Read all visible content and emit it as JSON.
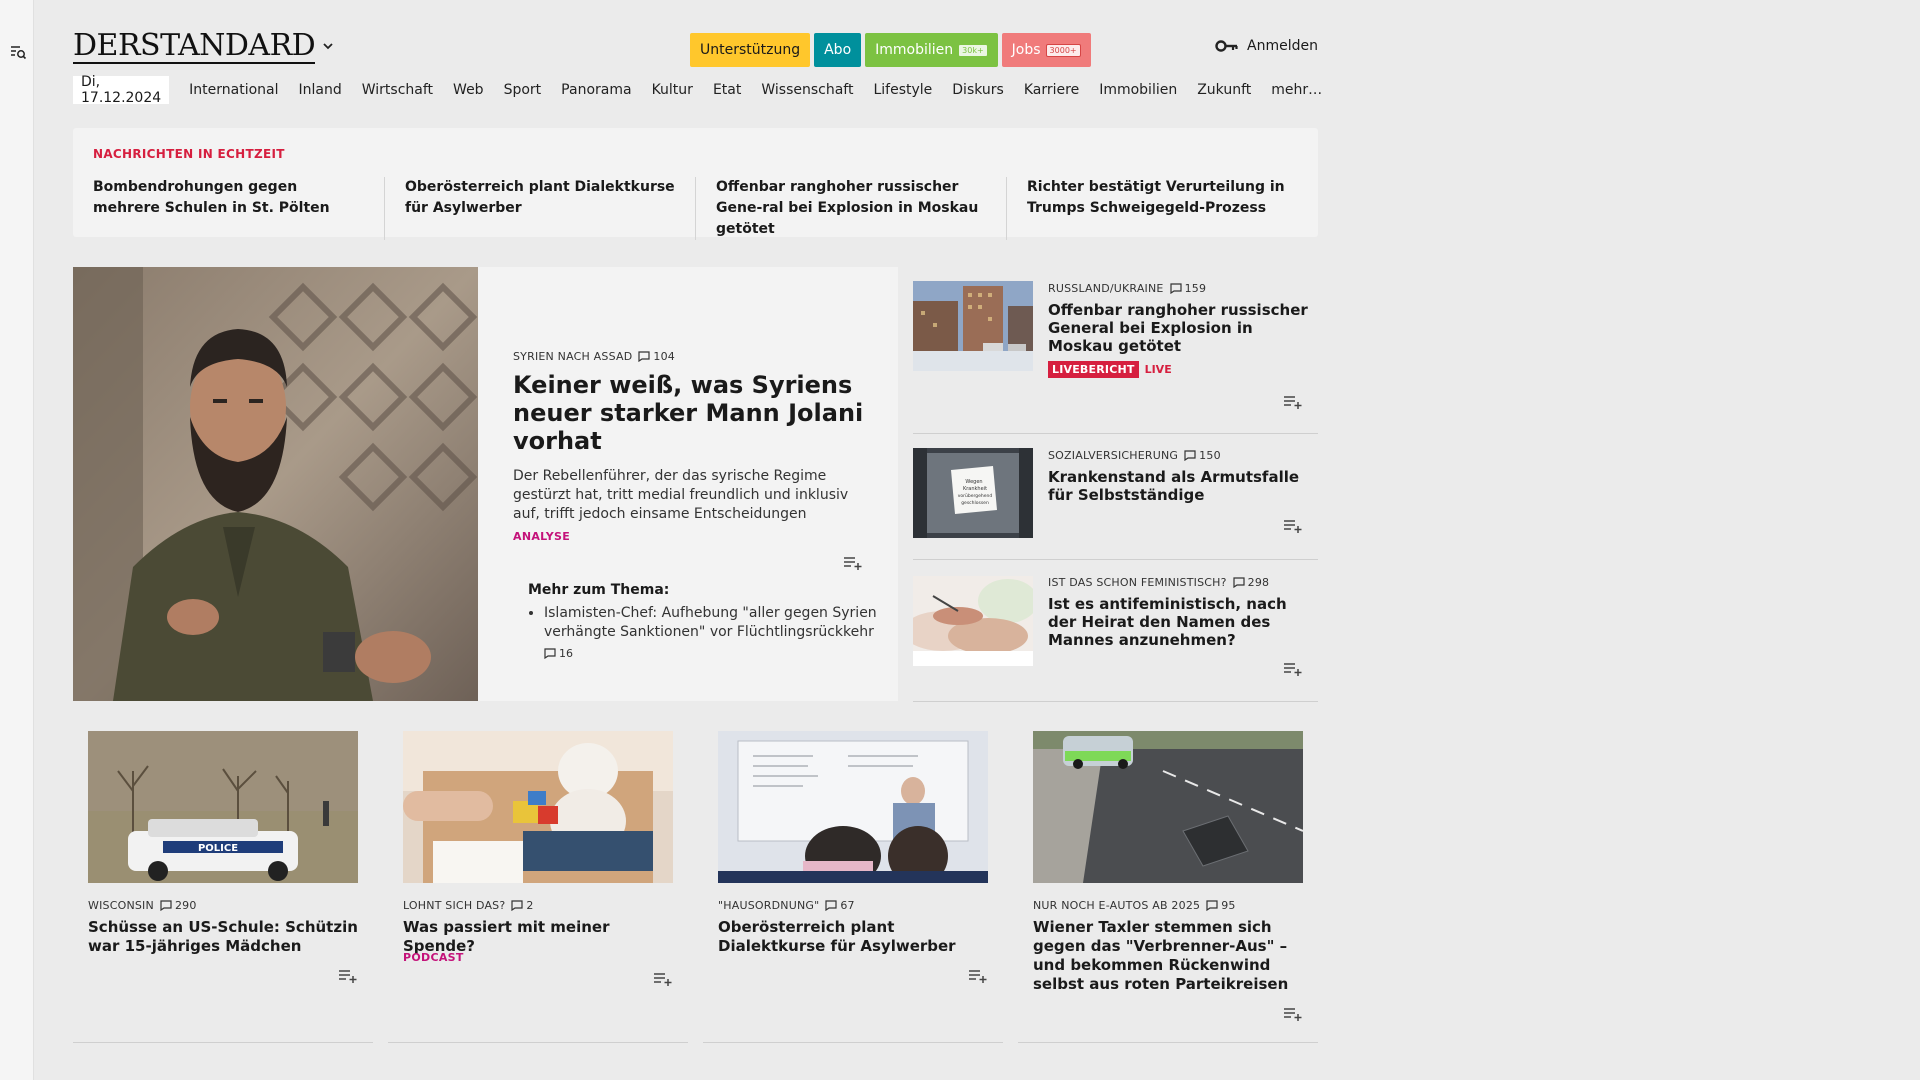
{
  "header": {
    "logo": "DERSTANDARD",
    "pills": [
      {
        "label": "Unterstützung",
        "badge": "",
        "bg": "#ffc72c",
        "fg": "#1a1a1a"
      },
      {
        "label": "Abo",
        "badge": "",
        "bg": "#00909c",
        "fg": "#ffffff"
      },
      {
        "label": "Immobilien",
        "badge": "30k+",
        "bg": "#7cc242",
        "fg": "#ffffff"
      },
      {
        "label": "Jobs",
        "badge": "3000+",
        "bg": "#f07b7b",
        "fg": "#ffffff"
      }
    ],
    "login": "Anmelden"
  },
  "nav": {
    "date": "Di, 17.12.2024",
    "items": [
      "International",
      "Inland",
      "Wirtschaft",
      "Web",
      "Sport",
      "Panorama",
      "Kultur",
      "Etat",
      "Wissenschaft",
      "Lifestyle",
      "Diskurs",
      "Karriere",
      "Immobilien",
      "Zukunft",
      "mehr…"
    ]
  },
  "ticker": {
    "label": "NACHRICHTEN IN ECHTZEIT",
    "items": [
      "Bombendrohungen gegen mehrere Schulen in St. Pölten",
      "Oberösterreich plant Dialektkurse für Asylwerber",
      "Offenbar ranghoher russischer Gene-ral bei Explosion in Moskau getötet",
      "Richter bestätigt Verurteilung in Trumps Schweigegeld-Prozess"
    ]
  },
  "lead": {
    "kicker": "SYRIEN NACH ASSAD",
    "comments": "104",
    "title": "Keiner weiß, was Syriens neuer starker Mann Jolani vorhat",
    "teaser": "Der Rebellenführer, der das syrische Regime gestürzt hat, tritt medial freundlich und inklusiv auf, trifft jedoch einsame Entscheidungen",
    "tag": "ANALYSE",
    "more_title": "Mehr zum Thema:",
    "more_item": "Islamisten-Chef: Aufhebung \"aller gegen Syrien verhängte Sanktionen\" vor Flüchtlingsrückkehr",
    "more_comments": "16"
  },
  "side": [
    {
      "kicker": "RUSSLAND/UKRAINE",
      "comments": "159",
      "title": "Offenbar ranghoher russischer General bei Explosion in Moskau getötet",
      "live_badge": "LIVEBERICHT",
      "live": "LIVE"
    },
    {
      "kicker": "SOZIALVERSICHERUNG",
      "comments": "150",
      "title": "Krankenstand als Armutsfalle für Selbstständige"
    },
    {
      "kicker": "IST DAS SCHON FEMINISTISCH?",
      "comments": "298",
      "title": "Ist es antifeministisch, nach der Heirat den Namen des Mannes anzunehmen?"
    }
  ],
  "cards": [
    {
      "kicker": "WISCONSIN",
      "comments": "290",
      "title": "Schüsse an US-Schule: Schützin war 15-jähriges Mädchen",
      "tag": "",
      "img_text": "POLICE"
    },
    {
      "kicker": "LOHNT SICH DAS?",
      "comments": "2",
      "title": "Was passiert mit meiner Spende?",
      "tag": "PODCAST"
    },
    {
      "kicker": "\"HAUSORDNUNG\"",
      "comments": "67",
      "title": "Oberösterreich plant Dialektkurse für Asylwerber",
      "tag": ""
    },
    {
      "kicker": "NUR NOCH E-AUTOS AB 2025",
      "comments": "95",
      "title": "Wiener Taxler stemmen sich gegen das \"Verbrenner-Aus\" – und bekommen Rückenwind selbst aus roten Parteikreisen",
      "tag": ""
    }
  ],
  "side_thumb_text": "Wegen Krankheit vorübergehend geschlossen",
  "colors": {
    "red": "#d61f3f",
    "magenta": "#c4127a",
    "bg": "#ebebeb",
    "panel": "#f3f3f3"
  }
}
